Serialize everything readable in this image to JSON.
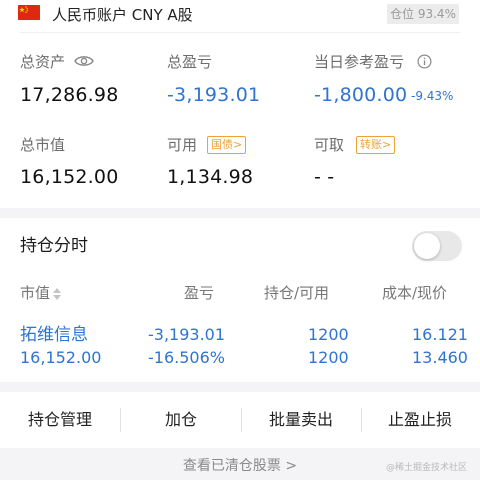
{
  "account": {
    "name": "人民币账户 CNY A股",
    "position_ratio": "仓位 93.4%",
    "total_assets_label": "总资产",
    "total_assets": "17,286.98",
    "total_pnl_label": "总盈亏",
    "total_pnl": "-3,193.01",
    "daily_pnl_label": "当日参考盈亏",
    "daily_pnl": "-1,800.00",
    "daily_pnl_pct": "-9.43%",
    "market_value_label": "总市值",
    "market_value": "16,152.00",
    "available_label": "可用",
    "available": "1,134.98",
    "available_tag": "国债>",
    "withdrawable_label": "可取",
    "withdrawable": "- -",
    "withdrawable_tag": "转账>"
  },
  "positions": {
    "title": "持仓分时",
    "toggle_on": false,
    "columns": [
      "市值",
      "盈亏",
      "持仓/可用",
      "成本/现价"
    ],
    "rows": [
      {
        "name": "拓维信息",
        "market_value": "16,152.00",
        "pnl": "-3,193.01",
        "pnl_pct": "-16.506%",
        "holding": "1200",
        "available": "1200",
        "cost": "16.121",
        "price": "13.460"
      }
    ]
  },
  "actions": [
    "持仓管理",
    "加仓",
    "批量卖出",
    "止盈止损"
  ],
  "cleared_link": "查看已清仓股票 >",
  "watermark": "@稀土掘金技术社区",
  "icons": {
    "flag": "china-flag-icon",
    "eye": "eye-icon",
    "info": "info-circle-icon",
    "sort": "sort-icon"
  },
  "colors": {
    "loss": "#2f74d0",
    "tag": "#f0a135"
  }
}
